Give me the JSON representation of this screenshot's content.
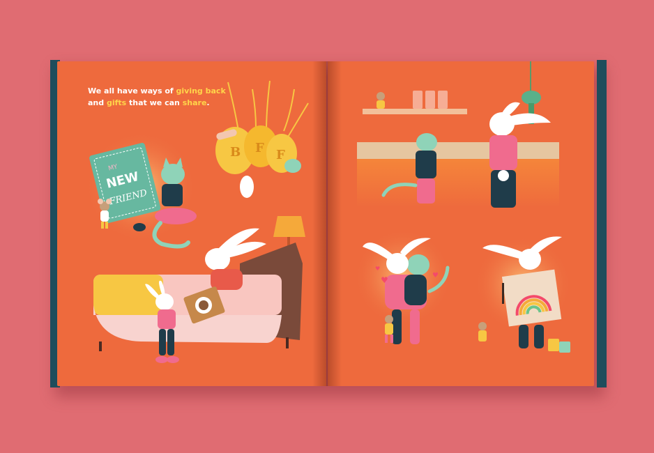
{
  "caption": {
    "part1": "We all have ways of ",
    "highlight1": "giving back",
    "part2": " and ",
    "highlight2": "gifts",
    "part3": " that we can ",
    "highlight3": "share",
    "part4": "."
  },
  "book_card": {
    "line1": "MY",
    "line2": "NEW",
    "line3": "FRIEND"
  },
  "necklace_letters": [
    "B",
    "F",
    "F"
  ],
  "colors": {
    "background": "#e06c72",
    "page": "#ee6a3d",
    "cover": "#1f4d5c",
    "highlight_text": "#ffd54a",
    "bunny": "#ffffff",
    "cat": "#8fd3b8",
    "pink": "#f06b8e"
  }
}
